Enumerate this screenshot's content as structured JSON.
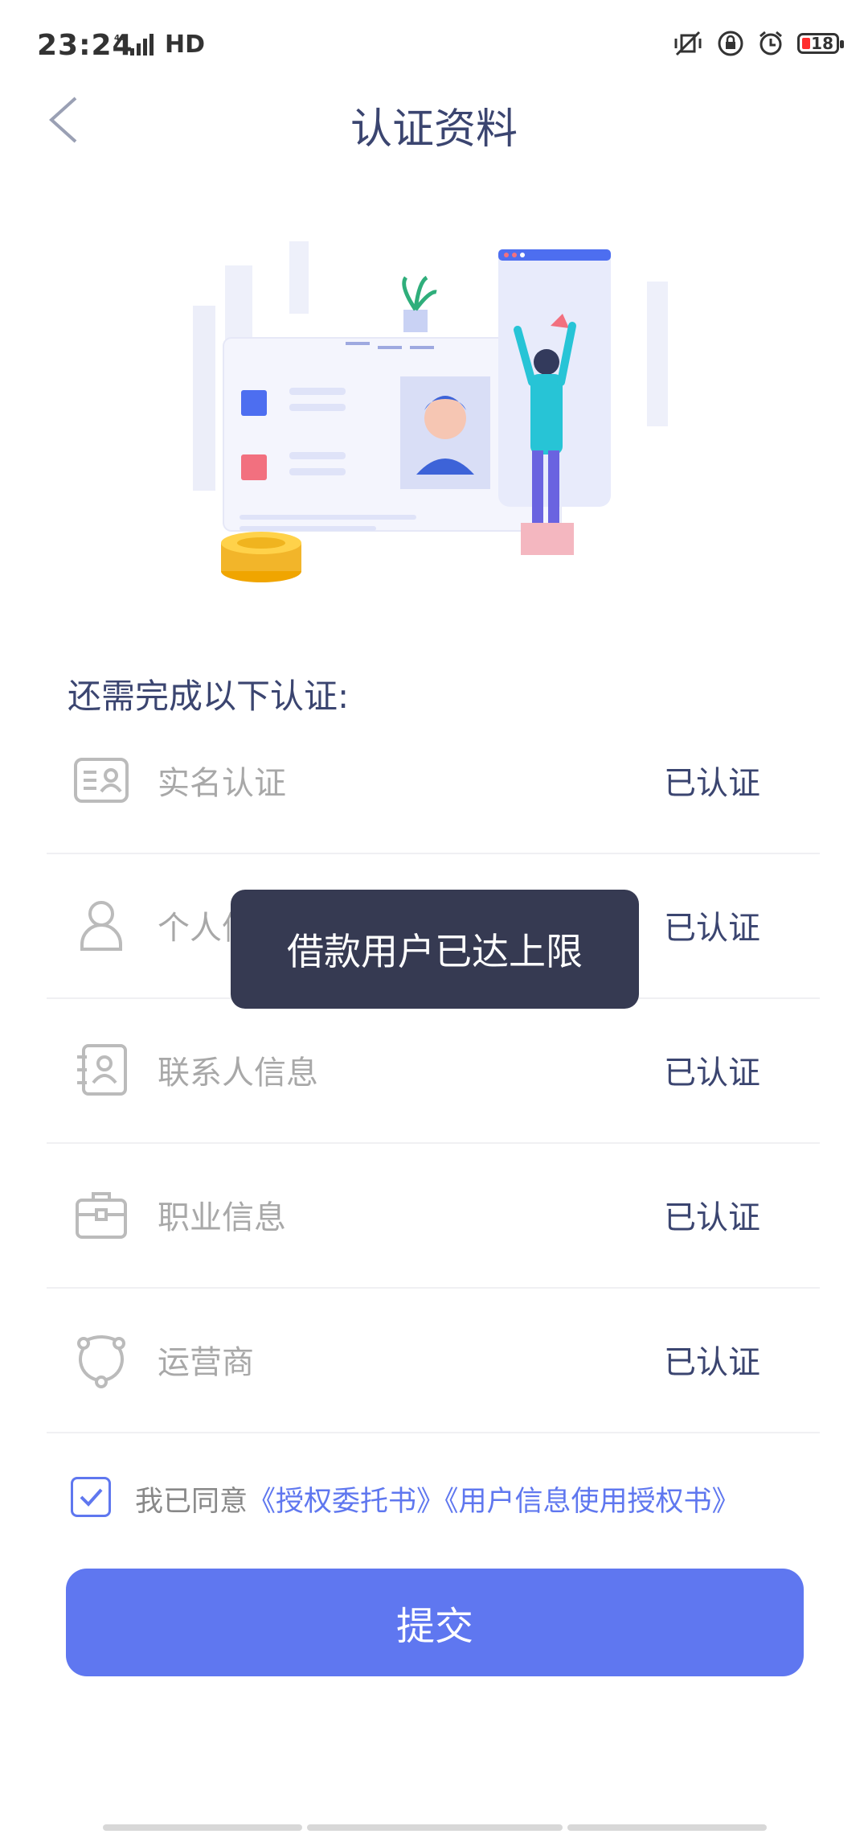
{
  "status_bar": {
    "time": "23:24",
    "network": "4G",
    "hd": "HD",
    "battery": "18"
  },
  "header": {
    "title": "认证资料",
    "back_icon": "chevron-left-icon"
  },
  "section_heading": "还需完成以下认证:",
  "items": [
    {
      "label": "实名认证",
      "status": "已认证",
      "icon": "id-card-icon"
    },
    {
      "label": "个人信息",
      "status": "已认证",
      "icon": "person-icon"
    },
    {
      "label": "联系人信息",
      "status": "已认证",
      "icon": "contact-book-icon"
    },
    {
      "label": "职业信息",
      "status": "已认证",
      "icon": "briefcase-icon"
    },
    {
      "label": "运营商",
      "status": "已认证",
      "icon": "carrier-icon"
    }
  ],
  "toast": "借款用户已达上限",
  "agreement": {
    "prefix": "我已同意",
    "link1": "《授权委托书》",
    "link2": "《用户信息使用授权书》",
    "checked": true
  },
  "submit_label": "提交",
  "colors": {
    "accent": "#5f77f0",
    "title": "#3b4570",
    "toast_bg": "#363a52"
  }
}
